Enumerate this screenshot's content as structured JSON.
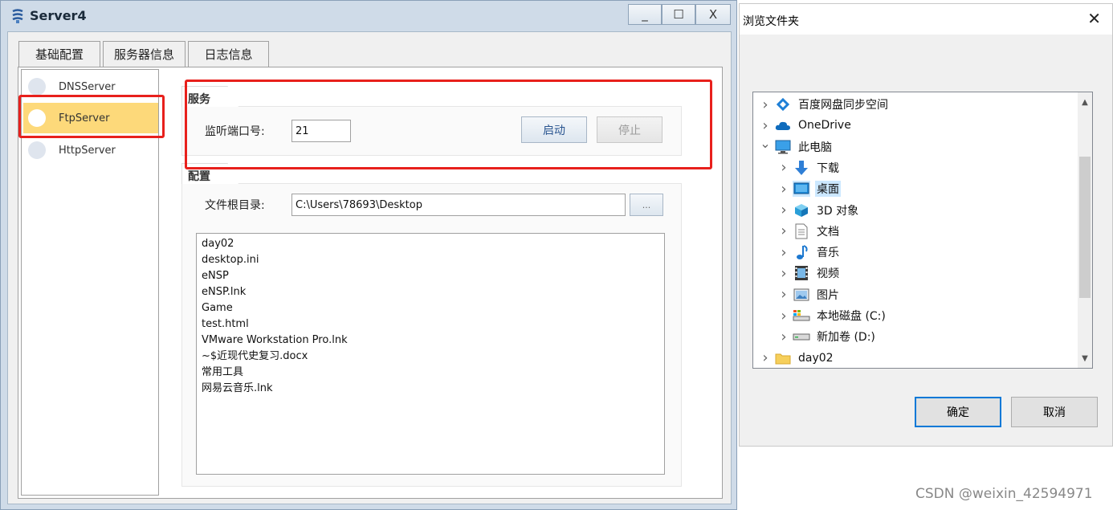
{
  "app_window": {
    "title": "Server4",
    "caption_buttons": {
      "minimize": "_",
      "maximize": "☐",
      "close": "X"
    },
    "tabs": [
      {
        "label": "基础配置",
        "active": false
      },
      {
        "label": "服务器信息",
        "active": false
      },
      {
        "label": "日志信息",
        "active": false
      }
    ],
    "server_list": [
      {
        "label": "DNSServer",
        "selected": false
      },
      {
        "label": "FtpServer",
        "selected": true
      },
      {
        "label": "HttpServer",
        "selected": false
      }
    ],
    "service_group": {
      "title": "服务",
      "port_label": "监听端口号:",
      "port_value": "21",
      "start_label": "启动",
      "stop_label": "停止"
    },
    "config_group": {
      "title": "配置",
      "root_dir_label": "文件根目录:",
      "root_dir_value": "C:\\Users\\78693\\Desktop",
      "browse_label": "...",
      "files": [
        "day02",
        "desktop.ini",
        "eNSP",
        "eNSP.lnk",
        "Game",
        "test.html",
        "VMware Workstation Pro.lnk",
        "~$近现代史复习.docx",
        "常用工具",
        "网易云音乐.lnk"
      ]
    },
    "highlight_color": "#e8201c",
    "selection_color": "#fdd97a"
  },
  "browse_dialog": {
    "title": "浏览文件夹",
    "close_glyph": "✕",
    "tree": [
      {
        "label": "百度网盘同步空间",
        "icon": "baidu-sync-icon",
        "level": 0,
        "expanded": false,
        "selected": false
      },
      {
        "label": "OneDrive",
        "icon": "cloud-icon",
        "level": 0,
        "expanded": false,
        "selected": false
      },
      {
        "label": "此电脑",
        "icon": "computer-icon",
        "level": 0,
        "expanded": true,
        "selected": false
      },
      {
        "label": "下载",
        "icon": "download-icon",
        "level": 1,
        "expanded": false,
        "selected": false
      },
      {
        "label": "桌面",
        "icon": "desktop-icon",
        "level": 1,
        "expanded": false,
        "selected": true
      },
      {
        "label": "3D 对象",
        "icon": "cube-icon",
        "level": 1,
        "expanded": false,
        "selected": false
      },
      {
        "label": "文档",
        "icon": "document-icon",
        "level": 1,
        "expanded": false,
        "selected": false
      },
      {
        "label": "音乐",
        "icon": "music-icon",
        "level": 1,
        "expanded": false,
        "selected": false
      },
      {
        "label": "视频",
        "icon": "video-icon",
        "level": 1,
        "expanded": false,
        "selected": false
      },
      {
        "label": "图片",
        "icon": "picture-icon",
        "level": 1,
        "expanded": false,
        "selected": false
      },
      {
        "label": "本地磁盘 (C:)",
        "icon": "system-drive-icon",
        "level": 1,
        "expanded": false,
        "selected": false
      },
      {
        "label": "新加卷 (D:)",
        "icon": "drive-icon",
        "level": 1,
        "expanded": false,
        "selected": false
      },
      {
        "label": "day02",
        "icon": "folder-icon",
        "level": 0,
        "expanded": false,
        "selected": false
      }
    ],
    "ok_label": "确定",
    "cancel_label": "取消",
    "accent_color": "#0078d7"
  },
  "watermark": "CSDN @weixin_42594971"
}
